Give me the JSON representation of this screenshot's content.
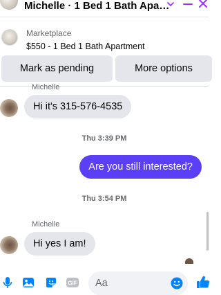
{
  "header": {
    "title": "Michelle · 1 Bed 1 Bath Apa…",
    "chevron_icon": "chevron-down-icon",
    "minimize_icon": "minimize-icon",
    "close_icon": "close-icon",
    "accent_color": "#a033ff"
  },
  "marketplace": {
    "label": "Marketplace",
    "listing_title": "$550 - 1 Bed 1 Bath Apartment",
    "buttons": {
      "mark_pending": "Mark as pending",
      "more_options": "More options"
    }
  },
  "conversation": {
    "partial_sender": "Michelle",
    "messages": [
      {
        "type": "incoming",
        "text": "Hi it's 315-576-4535"
      },
      {
        "type": "timestamp",
        "text": "Thu 3:39 PM"
      },
      {
        "type": "outgoing",
        "text": "Are you still interested?"
      },
      {
        "type": "timestamp",
        "text": "Thu 3:54 PM"
      },
      {
        "type": "sender",
        "text": "Michelle"
      },
      {
        "type": "incoming",
        "text": "Hi yes I am!"
      }
    ],
    "outgoing_bubble_color": "#5b3ff6",
    "incoming_bubble_color": "#e4e6eb"
  },
  "composer": {
    "placeholder": "Aa",
    "icons": [
      "microphone-icon",
      "photo-icon",
      "sticker-icon",
      "gif-icon",
      "emoji-icon",
      "thumbs-up-icon"
    ],
    "gif_label": "GIF",
    "icon_color": "#0084ff"
  }
}
